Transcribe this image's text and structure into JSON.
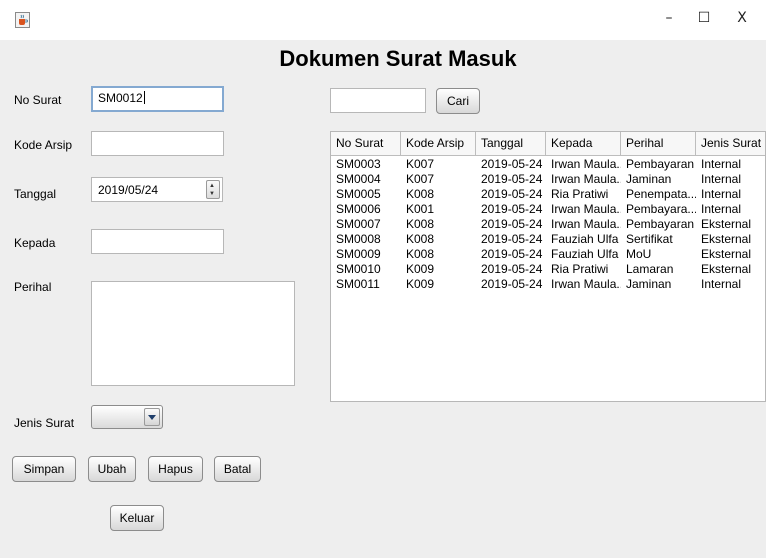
{
  "window": {
    "icon": "java-cup-icon",
    "controls": {
      "minimize": "–",
      "maximize": "☐",
      "close": "X"
    }
  },
  "title": "Dokumen Surat Masuk",
  "form": {
    "no_surat": {
      "label": "No Surat",
      "value": "SM0012"
    },
    "kode_arsip": {
      "label": "Kode Arsip",
      "value": ""
    },
    "tanggal": {
      "label": "Tanggal",
      "value": "2019/05/24"
    },
    "kepada": {
      "label": "Kepada",
      "value": ""
    },
    "perihal": {
      "label": "Perihal",
      "value": ""
    },
    "jenis_surat": {
      "label": "Jenis Surat",
      "value": ""
    }
  },
  "buttons": {
    "simpan": "Simpan",
    "ubah": "Ubah",
    "hapus": "Hapus",
    "batal": "Batal",
    "keluar": "Keluar"
  },
  "search": {
    "value": "",
    "button": "Cari"
  },
  "table": {
    "columns": [
      "No Surat",
      "Kode Arsip",
      "Tanggal",
      "Kepada",
      "Perihal",
      "Jenis Surat"
    ],
    "rows": [
      [
        "SM0003",
        "K007",
        "2019-05-24",
        "Irwan Maula...",
        "Pembayaran",
        "Internal"
      ],
      [
        "SM0004",
        "K007",
        "2019-05-24",
        "Irwan Maula...",
        "Jaminan",
        "Internal"
      ],
      [
        "SM0005",
        "K008",
        "2019-05-24",
        "Ria Pratiwi",
        "Penempata...",
        "Internal"
      ],
      [
        "SM0006",
        "K001",
        "2019-05-24",
        "Irwan Maula...",
        "Pembayara...",
        "Internal"
      ],
      [
        "SM0007",
        "K008",
        "2019-05-24",
        "Irwan Maula...",
        "Pembayaran",
        "Eksternal"
      ],
      [
        "SM0008",
        "K008",
        "2019-05-24",
        "Fauziah Ulfa",
        "Sertifikat",
        "Eksternal"
      ],
      [
        "SM0009",
        "K008",
        "2019-05-24",
        "Fauziah Ulfa",
        "MoU",
        "Eksternal"
      ],
      [
        "SM0010",
        "K009",
        "2019-05-24",
        "Ria Pratiwi",
        "Lamaran",
        "Eksternal"
      ],
      [
        "SM0011",
        "K009",
        "2019-05-24",
        "Irwan Maula...",
        "Jaminan",
        "Internal"
      ]
    ]
  }
}
